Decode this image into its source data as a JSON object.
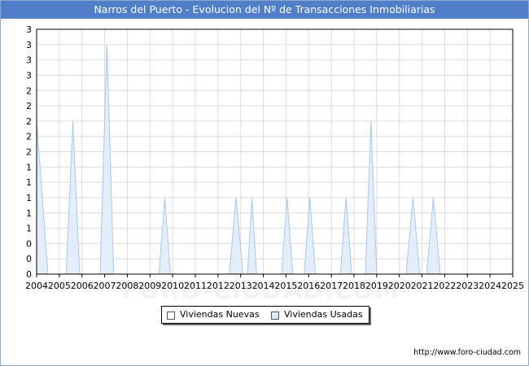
{
  "title": "Narros del Puerto - Evolucion del Nº de Transacciones Inmobiliarias",
  "source_url": "http://www.foro-ciudad.com",
  "watermark": "FORO-CIUDAD.COM",
  "legend": {
    "items": [
      {
        "label": "Viviendas Nuevas",
        "color": "#ffffff"
      },
      {
        "label": "Viviendas Usadas",
        "color": "#dde9f8"
      }
    ]
  },
  "chart_data": {
    "type": "area",
    "title": "Narros del Puerto - Evolucion del Nº de Transacciones Inmobiliarias",
    "x": [
      "2004",
      "2005",
      "2006",
      "2007",
      "2008",
      "2009",
      "2010",
      "2011",
      "2012",
      "2013",
      "2014",
      "2015",
      "2016",
      "2017",
      "2018",
      "2019",
      "2020",
      "2021",
      "2022",
      "2023",
      "2024",
      "2025"
    ],
    "ylim": [
      0,
      3.2
    ],
    "y_tick_labels": [
      "0",
      "0",
      "0",
      "1",
      "1",
      "1",
      "1",
      "1",
      "2",
      "2",
      "2",
      "2",
      "2",
      "3",
      "3",
      "3",
      "3"
    ],
    "grid": true,
    "legend_position": "bottom",
    "series": [
      {
        "name": "Viviendas Nuevas",
        "color": "#000000",
        "points": [
          [
            2004.0,
            1
          ],
          [
            2004.25,
            0
          ]
        ]
      },
      {
        "name": "Viviendas Usadas",
        "color": "#a9c8ea",
        "points": [
          [
            2004.0,
            2
          ],
          [
            2004.5,
            0
          ],
          [
            2005.3,
            0
          ],
          [
            2005.6,
            2
          ],
          [
            2005.9,
            0
          ],
          [
            2006.8,
            0
          ],
          [
            2007.1,
            3
          ],
          [
            2007.4,
            0
          ],
          [
            2009.4,
            0
          ],
          [
            2009.65,
            1
          ],
          [
            2009.9,
            0
          ],
          [
            2012.5,
            0
          ],
          [
            2012.8,
            1
          ],
          [
            2013.1,
            0
          ],
          [
            2013.3,
            0
          ],
          [
            2013.5,
            1
          ],
          [
            2013.7,
            0
          ],
          [
            2014.8,
            0
          ],
          [
            2015.05,
            1
          ],
          [
            2015.3,
            0
          ],
          [
            2015.8,
            0
          ],
          [
            2016.05,
            1
          ],
          [
            2016.3,
            0
          ],
          [
            2017.4,
            0
          ],
          [
            2017.65,
            1
          ],
          [
            2017.9,
            0
          ],
          [
            2018.5,
            0
          ],
          [
            2018.75,
            2
          ],
          [
            2019.0,
            0
          ],
          [
            2020.3,
            0
          ],
          [
            2020.6,
            1
          ],
          [
            2020.9,
            0
          ],
          [
            2021.2,
            0
          ],
          [
            2021.5,
            1
          ],
          [
            2021.8,
            0
          ]
        ]
      }
    ]
  }
}
